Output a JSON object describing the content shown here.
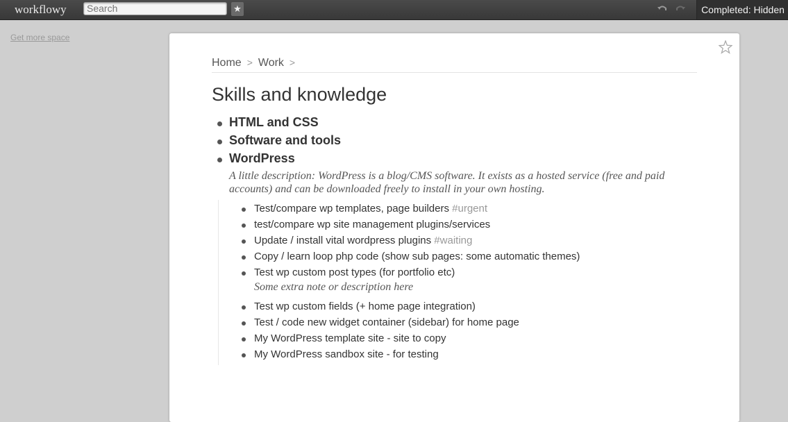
{
  "topbar": {
    "logo": "workflowy",
    "search_placeholder": "Search",
    "star_glyph": "★",
    "completed_label": "Completed: Hidden"
  },
  "sidebar": {
    "get_more_space": "Get more space"
  },
  "breadcrumb": {
    "items": [
      "Home",
      "Work"
    ],
    "separator": ">"
  },
  "page": {
    "title": "Skills and knowledge",
    "items": [
      {
        "label": "HTML and CSS"
      },
      {
        "label": "Software and tools"
      },
      {
        "label": "WordPress",
        "note": "A little description: WordPress is a blog/CMS software. It exists as a hosted service (free and paid accounts) and can be downloaded freely to install in your own hosting."
      }
    ],
    "wordpress_children": [
      {
        "text": "Test/compare wp templates, page builders ",
        "tag": "#urgent"
      },
      {
        "text": "test/compare wp site management plugins/services",
        "tag": ""
      },
      {
        "text": "Update / install vital wordpress plugins ",
        "tag": "#waiting"
      },
      {
        "text": "Copy / learn loop php code (show sub pages: some automatic themes)",
        "tag": ""
      },
      {
        "text": "Test wp custom post types (for portfolio etc)",
        "tag": "",
        "note": "Some extra note or description here"
      },
      {
        "text": "Test wp custom fields (+ home page integration)",
        "tag": ""
      },
      {
        "text": "Test / code new widget container (sidebar) for home page",
        "tag": ""
      },
      {
        "text": "My WordPress template site - site to copy",
        "tag": ""
      },
      {
        "text": "My WordPress sandbox site - for testing",
        "tag": ""
      }
    ]
  }
}
